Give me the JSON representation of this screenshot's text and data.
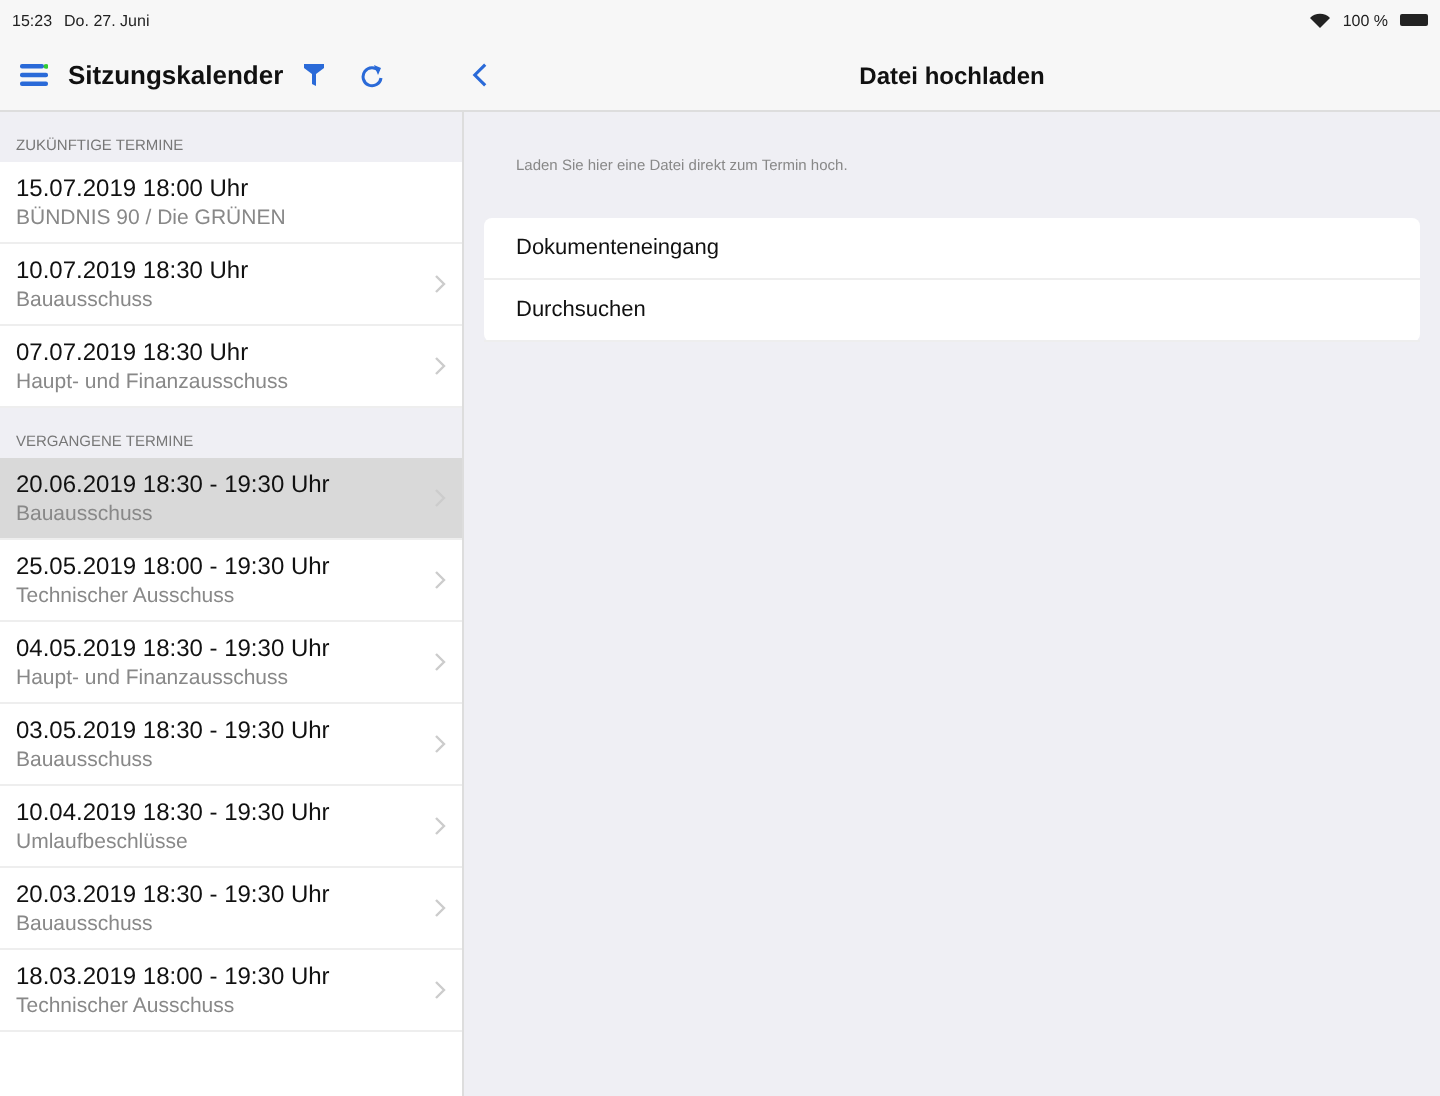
{
  "status_bar": {
    "time": "15:23",
    "date": "Do. 27. Juni",
    "battery": "100 %"
  },
  "sidebar": {
    "title": "Sitzungskalender",
    "sections": [
      {
        "header": "ZUKÜNFTIGE TERMINE",
        "items": [
          {
            "date": "15.07.2019 18:00 Uhr",
            "title": "BÜNDNIS 90 / Die GRÜNEN",
            "selected": false,
            "disclosure": false
          },
          {
            "date": "10.07.2019 18:30 Uhr",
            "title": "Bauausschuss",
            "selected": false,
            "disclosure": true
          },
          {
            "date": "07.07.2019 18:30 Uhr",
            "title": "Haupt- und Finanzausschuss",
            "selected": false,
            "disclosure": true
          }
        ]
      },
      {
        "header": "VERGANGENE TERMINE",
        "items": [
          {
            "date": "20.06.2019 18:30 -  19:30 Uhr",
            "title": "Bauausschuss",
            "selected": true,
            "disclosure": true
          },
          {
            "date": "25.05.2019 18:00 -  19:30 Uhr",
            "title": "Technischer Ausschuss",
            "selected": false,
            "disclosure": true
          },
          {
            "date": "04.05.2019 18:30 -  19:30 Uhr",
            "title": "Haupt- und Finanzausschuss",
            "selected": false,
            "disclosure": true
          },
          {
            "date": "03.05.2019 18:30 -  19:30 Uhr",
            "title": "Bauausschuss",
            "selected": false,
            "disclosure": true
          },
          {
            "date": "10.04.2019 18:30 -  19:30 Uhr",
            "title": "Umlaufbeschlüsse",
            "selected": false,
            "disclosure": true
          },
          {
            "date": "20.03.2019 18:30 -  19:30 Uhr",
            "title": "Bauausschuss",
            "selected": false,
            "disclosure": true
          },
          {
            "date": "18.03.2019 18:00 -  19:30 Uhr",
            "title": "Technischer Ausschuss",
            "selected": false,
            "disclosure": true
          }
        ]
      }
    ]
  },
  "detail": {
    "title": "Datei hochladen",
    "description": "Laden Sie hier eine Datei direkt zum Termin hoch.",
    "options": [
      "Dokumenteneingang",
      "Durchsuchen"
    ]
  }
}
